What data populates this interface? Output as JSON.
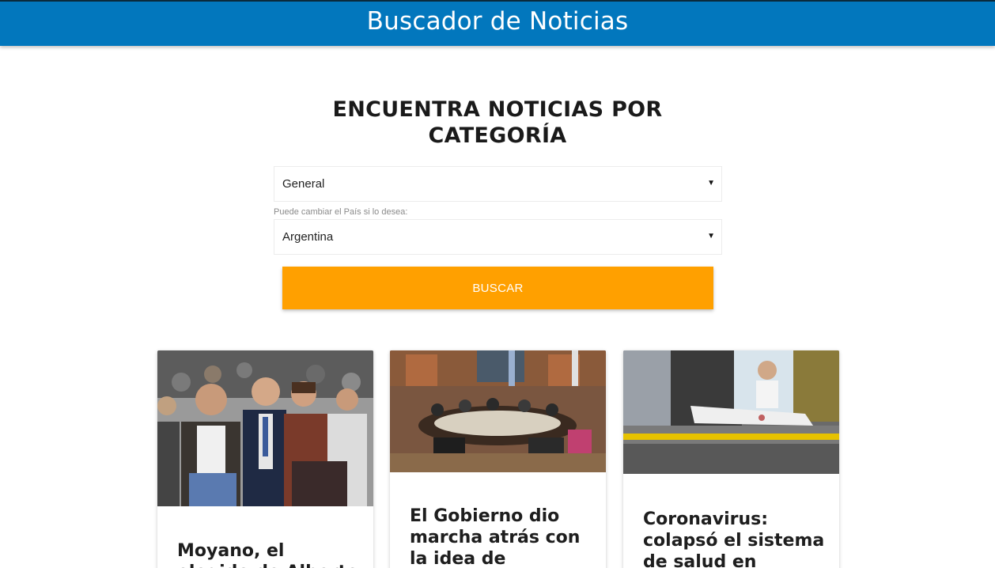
{
  "header": {
    "title": "Buscador de Noticias"
  },
  "form": {
    "heading": "ENCUENTRA NOTICIAS POR CATEGORÍA",
    "category": {
      "selected": "General"
    },
    "country_hint": "Puede cambiar el País si lo desea:",
    "country": {
      "selected": "Argentina"
    },
    "search_label": "BUSCAR"
  },
  "news": [
    {
      "title": "Moyano, el elegido de Alberto"
    },
    {
      "title": "El Gobierno dio marcha atrás con la idea de disponer de"
    },
    {
      "title": "Coronavirus: colapsó el sistema de salud en Ecuador"
    }
  ],
  "colors": {
    "header": "#0277bd",
    "button": "#ffa000"
  },
  "icons": {
    "select_arrow": "caret-down-icon"
  }
}
